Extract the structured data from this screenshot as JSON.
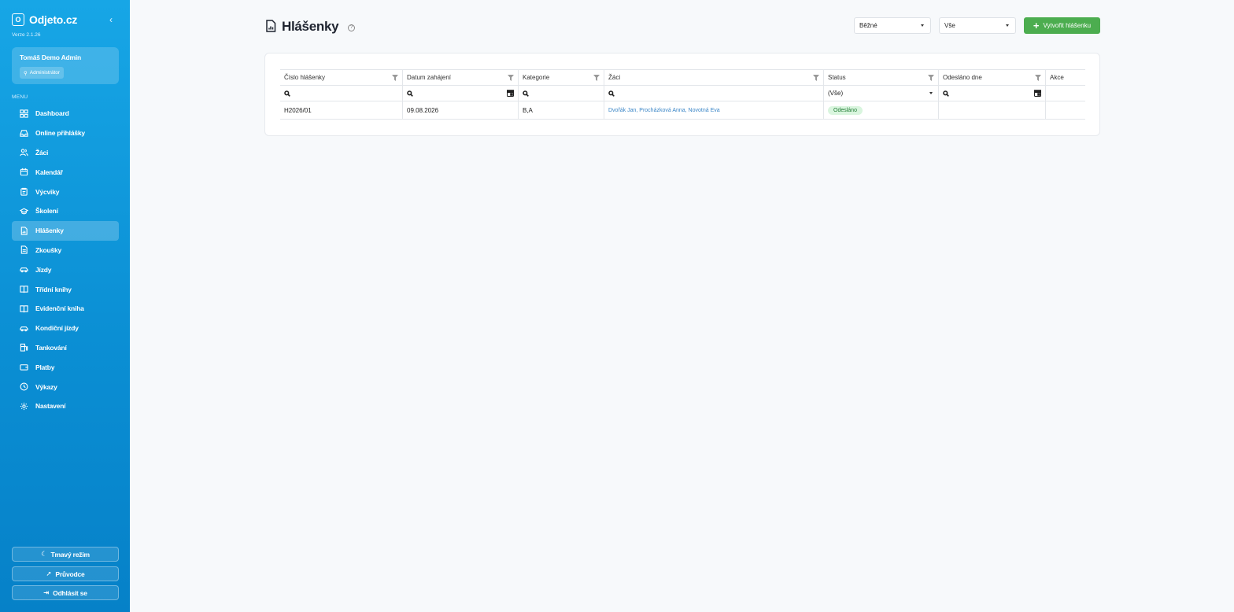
{
  "app": {
    "brand_letter": "O",
    "brand_name": "Odjeto.cz",
    "version": "Verze 2.1.26"
  },
  "user": {
    "name": "Tomáš Demo Admin",
    "role": "Administrátor"
  },
  "sidebar": {
    "menu_label": "MENU",
    "items": [
      {
        "label": "Dashboard",
        "icon": "dashboard-icon"
      },
      {
        "label": "Online přihlášky",
        "icon": "inbox-icon"
      },
      {
        "label": "Žáci",
        "icon": "users-icon"
      },
      {
        "label": "Kalendář",
        "icon": "calendar-icon"
      },
      {
        "label": "Výcviky",
        "icon": "clipboard-icon"
      },
      {
        "label": "Školení",
        "icon": "graduation-cap-icon"
      },
      {
        "label": "Hlášenky",
        "icon": "report-file-icon"
      },
      {
        "label": "Zkoušky",
        "icon": "document-icon"
      },
      {
        "label": "Jízdy",
        "icon": "car-icon"
      },
      {
        "label": "Třídní knihy",
        "icon": "book-icon"
      },
      {
        "label": "Evidenční kniha",
        "icon": "book-icon"
      },
      {
        "label": "Kondiční jízdy",
        "icon": "car-icon"
      },
      {
        "label": "Tankování",
        "icon": "fuel-icon"
      },
      {
        "label": "Platby",
        "icon": "wallet-icon"
      },
      {
        "label": "Výkazy",
        "icon": "clock-icon"
      },
      {
        "label": "Nastavení",
        "icon": "gear-icon"
      }
    ],
    "active_index": 6,
    "dark_mode": "Tmavý režim",
    "guide": "Průvodce",
    "logout": "Odhlásit se"
  },
  "header": {
    "title": "Hlášenky",
    "filter_type": "Běžné",
    "filter_scope": "Vše",
    "create_button": "Vytvořit hlášenku"
  },
  "table": {
    "columns": [
      "Číslo hlášenky",
      "Datum zahájení",
      "Kategorie",
      "Žáci",
      "Status",
      "Odesláno dne",
      "Akce"
    ],
    "status_filter": "(Vše)",
    "rows": [
      {
        "number": "H2026/01",
        "start_date": "09.08.2026",
        "category": "B,A",
        "students": "Dvořák Jan, Procházková Anna, Novotná Eva",
        "status": "Odesláno",
        "sent_date": "",
        "actions": ""
      }
    ]
  },
  "colors": {
    "sidebar_top": "#17a6e6",
    "sidebar_bottom": "#0681c8",
    "primary_button": "#4cad4f",
    "link": "#3b86c7",
    "status_sent_bg": "#d9f5de"
  }
}
